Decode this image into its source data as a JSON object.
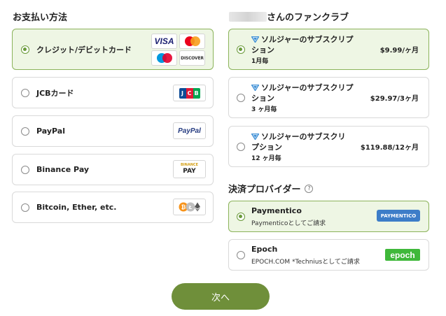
{
  "payment": {
    "title": "お支払い方法",
    "methods": [
      {
        "label": "クレジット/デビットカード",
        "selected": true
      },
      {
        "label": "JCBカード",
        "selected": false
      },
      {
        "label": "PayPal",
        "selected": false
      },
      {
        "label": "Binance Pay",
        "selected": false
      },
      {
        "label": "Bitcoin, Ether, etc.",
        "selected": false
      }
    ],
    "logos": {
      "visa": "VISA",
      "discover": "DISCOVER",
      "jcb": "JCB",
      "paypal": "PayPal",
      "binance_top": "BINANCE",
      "binance_bottom": "PAY"
    }
  },
  "fanclub": {
    "title_suffix": "さんのファンクラブ",
    "plans": [
      {
        "name_line1": "ソルジャーのサブスクリプ",
        "name_line2": "ション",
        "period": "1月毎",
        "price": "$9.99/ヶ月",
        "selected": true
      },
      {
        "name_line1": "ソルジャーのサブスクリプ",
        "name_line2": "ション",
        "period": "3 ヶ月毎",
        "price": "$29.97/3ヶ月",
        "selected": false
      },
      {
        "name_line1": "ソルジャーのサブスクリ",
        "name_line2": "プション",
        "period": "12 ヶ月毎",
        "price": "$119.88/12ヶ月",
        "selected": false
      }
    ]
  },
  "providers": {
    "title": "決済プロバイダー",
    "help_icon": "?",
    "items": [
      {
        "name": "Paymentico",
        "desc": "Paymenticoとしてご請求",
        "logo": "PAYMENTICO",
        "selected": true
      },
      {
        "name": "Epoch",
        "desc": "EPOCH.COM *Techniusとしてご請求",
        "logo": "epoch",
        "selected": false
      }
    ]
  },
  "actions": {
    "next_label": "次へ"
  },
  "colors": {
    "accent": "#6f8f3a",
    "selected_border": "#8bb35a",
    "selected_bg": "#eef6e4",
    "plan_icon": "#3d8fd6"
  }
}
